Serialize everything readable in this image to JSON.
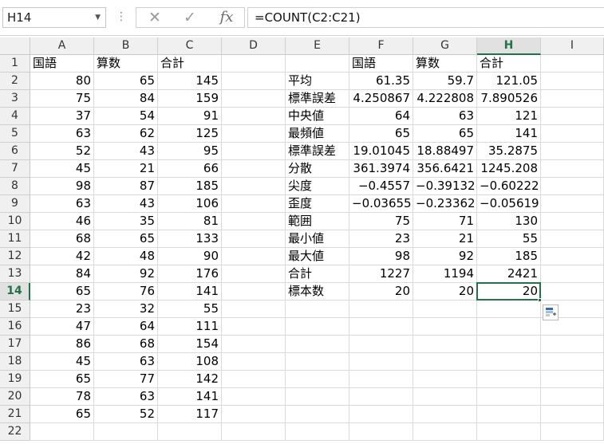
{
  "name_box": "H14",
  "formula": "=COUNT(C2:C21)",
  "formula_buttons": {
    "cancel": "✕",
    "enter": "✓",
    "fx": "fx"
  },
  "columns": [
    "A",
    "B",
    "C",
    "D",
    "E",
    "F",
    "G",
    "H",
    "I"
  ],
  "rows": [
    "1",
    "2",
    "3",
    "4",
    "5",
    "6",
    "7",
    "8",
    "9",
    "10",
    "11",
    "12",
    "13",
    "14",
    "15",
    "16",
    "17",
    "18",
    "19",
    "20",
    "21",
    "22"
  ],
  "selected_cell": {
    "column": "H",
    "row": "14"
  },
  "table_left": {
    "headers": [
      "国語",
      "算数",
      "合計"
    ],
    "rows": [
      [
        "80",
        "65",
        "145"
      ],
      [
        "75",
        "84",
        "159"
      ],
      [
        "37",
        "54",
        "91"
      ],
      [
        "63",
        "62",
        "125"
      ],
      [
        "52",
        "43",
        "95"
      ],
      [
        "45",
        "21",
        "66"
      ],
      [
        "98",
        "87",
        "185"
      ],
      [
        "63",
        "43",
        "106"
      ],
      [
        "46",
        "35",
        "81"
      ],
      [
        "68",
        "65",
        "133"
      ],
      [
        "42",
        "48",
        "90"
      ],
      [
        "84",
        "92",
        "176"
      ],
      [
        "65",
        "76",
        "141"
      ],
      [
        "23",
        "32",
        "55"
      ],
      [
        "47",
        "64",
        "111"
      ],
      [
        "86",
        "68",
        "154"
      ],
      [
        "45",
        "63",
        "108"
      ],
      [
        "65",
        "77",
        "142"
      ],
      [
        "78",
        "63",
        "141"
      ],
      [
        "65",
        "52",
        "117"
      ]
    ]
  },
  "table_stats": {
    "headers": [
      "",
      "国語",
      "算数",
      "合計"
    ],
    "rows": [
      [
        "平均",
        "61.35",
        "59.7",
        "121.05"
      ],
      [
        "標準誤差",
        "4.250867",
        "4.222808",
        "7.890526"
      ],
      [
        "中央値",
        "64",
        "63",
        "121"
      ],
      [
        "最頻値",
        "65",
        "65",
        "141"
      ],
      [
        "標準誤差",
        "19.01045",
        "18.88497",
        "35.2875"
      ],
      [
        "分散",
        "361.3974",
        "356.6421",
        "1245.208"
      ],
      [
        "尖度",
        "−0.4557",
        "−0.39132",
        "−0.60222"
      ],
      [
        "歪度",
        "−0.03655",
        "−0.23362",
        "−0.05619"
      ],
      [
        "範囲",
        "75",
        "71",
        "130"
      ],
      [
        "最小値",
        "23",
        "21",
        "55"
      ],
      [
        "最大値",
        "98",
        "92",
        "185"
      ],
      [
        "合計",
        "1227",
        "1194",
        "2421"
      ],
      [
        "標本数",
        "20",
        "20",
        "20"
      ]
    ]
  },
  "colors": {
    "accent": "#217346",
    "header_bg": "#f0f0f0",
    "gridline": "#dadada"
  }
}
